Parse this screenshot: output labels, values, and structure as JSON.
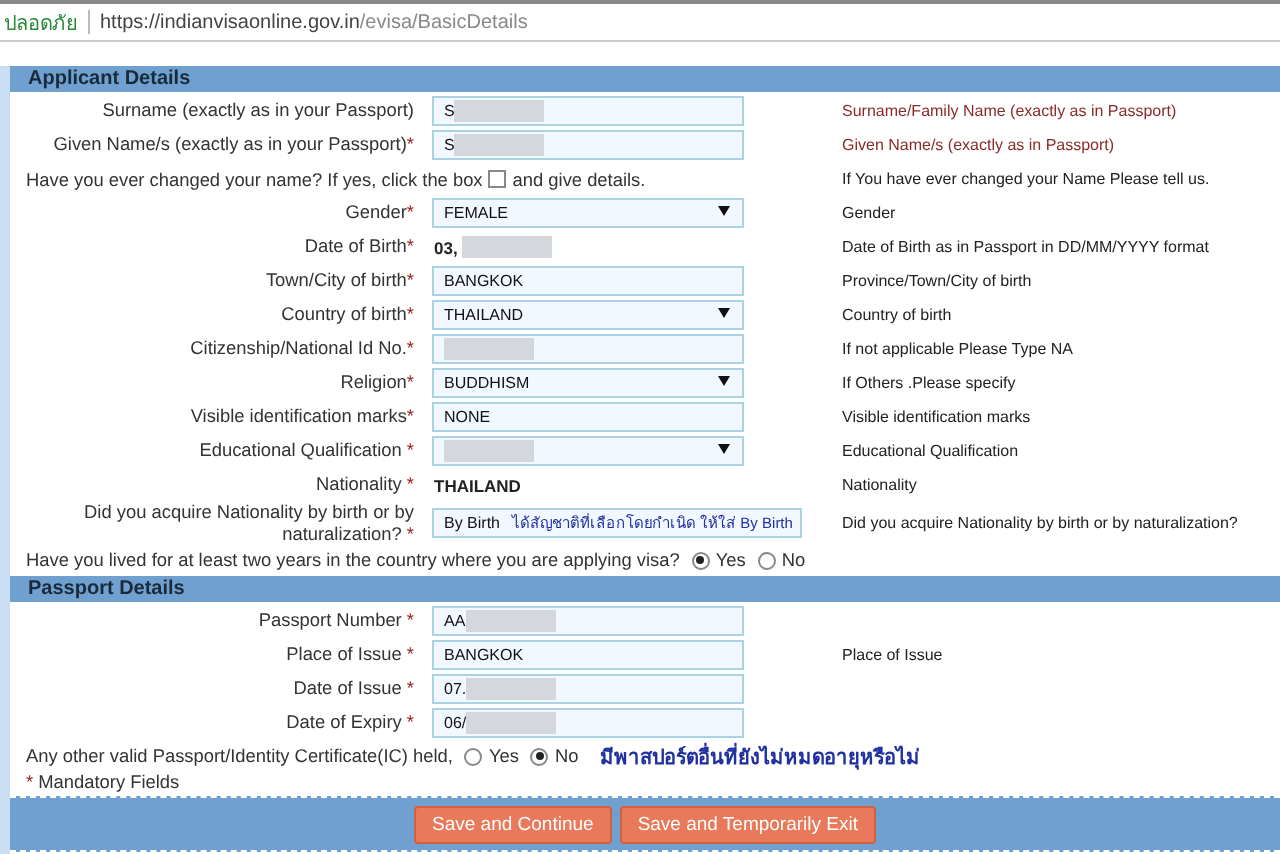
{
  "browser": {
    "security_label": "ปลอดภัย",
    "url_host": "https://indianvisaonline.gov.in",
    "url_path": "/evisa/BasicDetails"
  },
  "sections": [
    {
      "title": "Applicant Details",
      "rows": [
        {
          "kind": "input",
          "label": "Surname (exactly as in your Passport)",
          "required": false,
          "value": "S",
          "redacted": true,
          "help": "Surname/Family Name (exactly as in Passport)",
          "help_highlight": true
        },
        {
          "kind": "input",
          "label": "Given Name/s (exactly as in your Passport)",
          "required": true,
          "value": "S",
          "redacted": true,
          "help": "Given Name/s (exactly as in Passport)",
          "help_highlight": true
        },
        {
          "kind": "checkbox",
          "text_before": "Have you ever changed your name? If yes, click the box",
          "text_after": "and give details.",
          "checked": false,
          "help": "If You have ever changed your Name Please tell us."
        },
        {
          "kind": "select",
          "label": "Gender",
          "required": true,
          "value": "FEMALE",
          "redacted": false,
          "help": "Gender"
        },
        {
          "kind": "static",
          "label": "Date of Birth",
          "required": true,
          "value": "03,",
          "redacted": true,
          "help": "Date of Birth as in Passport in DD/MM/YYYY format"
        },
        {
          "kind": "input",
          "label": "Town/City of birth",
          "required": true,
          "value": "BANGKOK",
          "redacted": false,
          "help": "Province/Town/City of birth"
        },
        {
          "kind": "select",
          "label": "Country of birth",
          "required": true,
          "value": "THAILAND",
          "redacted": false,
          "help": "Country of birth"
        },
        {
          "kind": "input",
          "label": "Citizenship/National Id No.",
          "required": true,
          "value": "",
          "redacted": true,
          "help": "If not applicable Please Type NA"
        },
        {
          "kind": "select",
          "label": "Religion",
          "required": true,
          "value": "BUDDHISM",
          "redacted": false,
          "help": "If Others .Please specify"
        },
        {
          "kind": "input",
          "label": "Visible identification marks",
          "required": true,
          "value": "NONE",
          "redacted": false,
          "help": "Visible identification marks"
        },
        {
          "kind": "select",
          "label": "Educational Qualification ",
          "required": true,
          "value": "",
          "redacted": true,
          "help": "Educational Qualification"
        },
        {
          "kind": "static",
          "label": "Nationality ",
          "required": true,
          "value": "THAILAND",
          "redacted": false,
          "help": "Nationality"
        },
        {
          "kind": "input",
          "label": "Did you acquire Nationality by birth or by naturalization? ",
          "required": true,
          "value": "By Birth",
          "redacted": false,
          "note": "ได้สัญชาติที่เลือกโดยกำเนิด ให้ใส่ By Birth",
          "help": "Did you acquire Nationality by birth or by naturalization?"
        },
        {
          "kind": "radio",
          "text": "Have you lived for at least two years in the country where you are applying visa?",
          "options": [
            {
              "label": "Yes",
              "selected": true
            },
            {
              "label": "No",
              "selected": false
            }
          ]
        }
      ]
    },
    {
      "title": "Passport Details",
      "rows": [
        {
          "kind": "input",
          "label": "Passport Number ",
          "required": true,
          "value": "AA",
          "redacted": true
        },
        {
          "kind": "input",
          "label": "Place of Issue ",
          "required": true,
          "value": "BANGKOK",
          "redacted": false,
          "help": "Place of Issue"
        },
        {
          "kind": "input",
          "label": "Date of Issue ",
          "required": true,
          "value": "07.",
          "redacted": true
        },
        {
          "kind": "input",
          "label": "Date of Expiry ",
          "required": true,
          "value": "06/",
          "redacted": true
        },
        {
          "kind": "radio",
          "text": "Any other valid Passport/Identity Certificate(IC) held,",
          "options": [
            {
              "label": "Yes",
              "selected": false
            },
            {
              "label": "No",
              "selected": true
            }
          ],
          "note": "มีพาสปอร์ตอื่นที่ยังไม่หมดอายุหรือไม่"
        }
      ]
    }
  ],
  "mandatory": {
    "mark": "*",
    "text": "Mandatory Fields"
  },
  "buttons": [
    "Save and Continue",
    "Save and Temporarily Exit"
  ]
}
